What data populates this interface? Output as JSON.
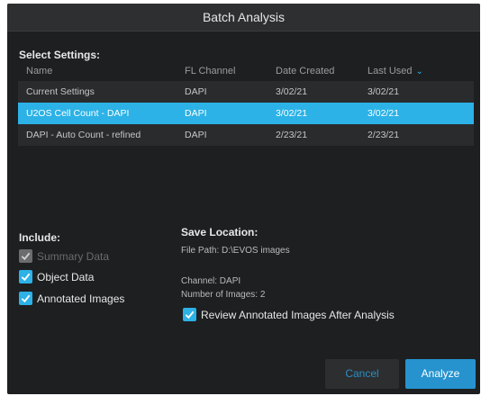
{
  "dialog": {
    "title": "Batch Analysis"
  },
  "select_settings": {
    "heading": "Select Settings:",
    "columns": [
      "Name",
      "FL Channel",
      "Date Created",
      "Last Used"
    ],
    "sort_indicator": "chevron-down-icon",
    "rows": [
      {
        "name": "Current Settings",
        "channel": "DAPI",
        "created": "3/02/21",
        "last_used": "3/02/21",
        "selected": false
      },
      {
        "name": "U2OS Cell Count - DAPI",
        "channel": "DAPI",
        "created": "3/02/21",
        "last_used": "3/02/21",
        "selected": true
      },
      {
        "name": "DAPI - Auto Count - refined",
        "channel": "DAPI",
        "created": "2/23/21",
        "last_used": "2/23/21",
        "selected": false
      }
    ]
  },
  "include": {
    "heading": "Include:",
    "options": [
      {
        "label": "Summary Data",
        "checked": true,
        "disabled": true
      },
      {
        "label": "Object Data",
        "checked": true,
        "disabled": false
      },
      {
        "label": "Annotated Images",
        "checked": true,
        "disabled": false
      }
    ]
  },
  "save_location": {
    "heading": "Save Location:",
    "file_path": "File Path: D:\\EVOS images",
    "channel": "Channel: DAPI",
    "num_images": "Number of Images: 2",
    "review_label": "Review Annotated Images After Analysis",
    "review_checked": true
  },
  "buttons": {
    "cancel": "Cancel",
    "analyze": "Analyze"
  },
  "colors": {
    "accent": "#2cb2e6",
    "background": "#1e1f21",
    "titlebar": "#2e2f31"
  }
}
